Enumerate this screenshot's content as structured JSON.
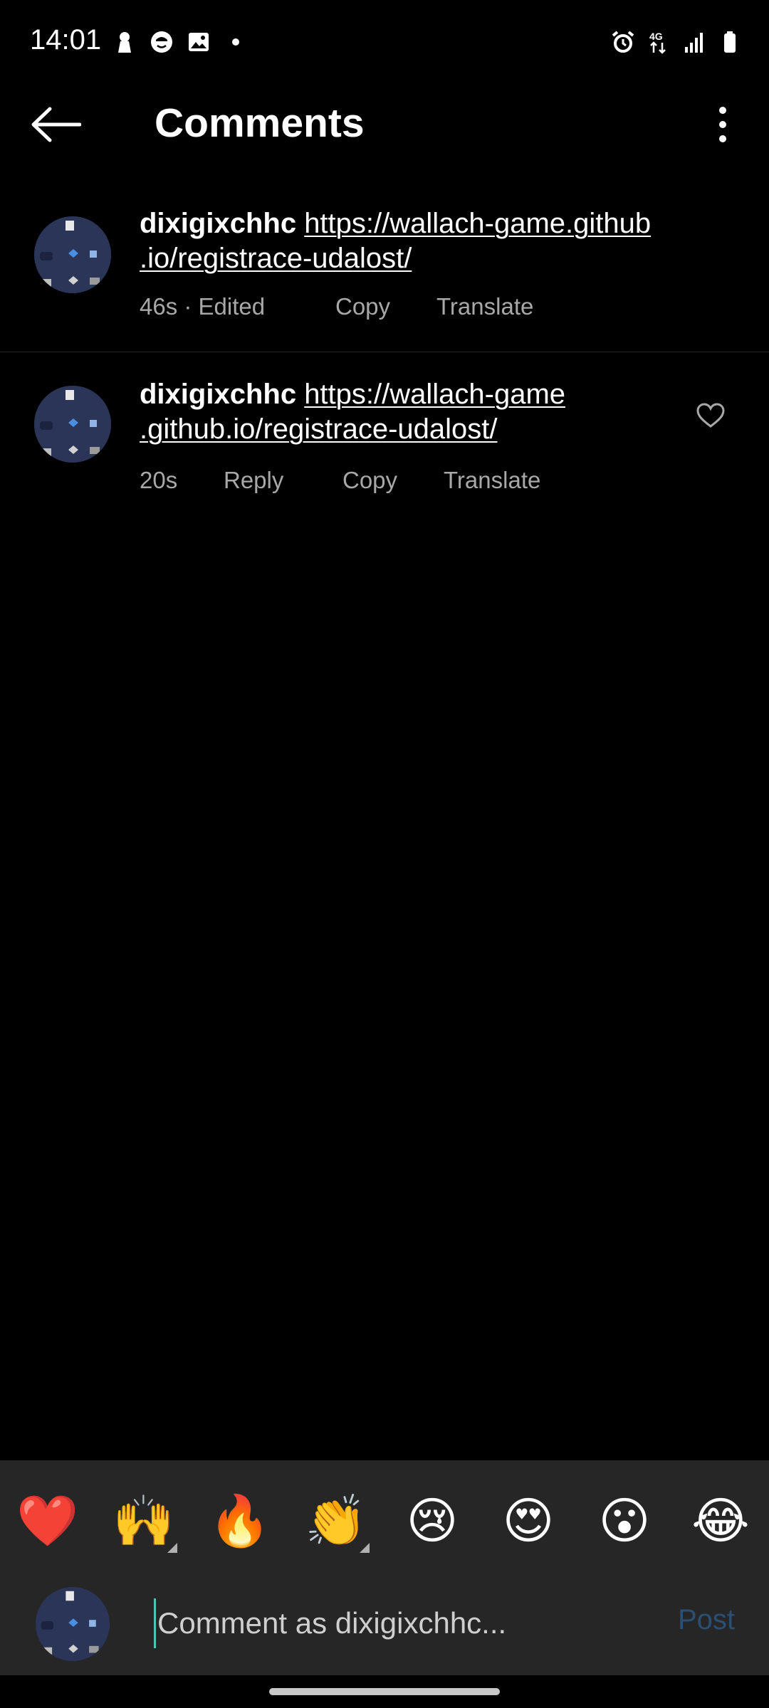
{
  "status_bar": {
    "time": "14:01",
    "left_icons": [
      "lock-person-icon",
      "face-icon",
      "image-icon",
      "dot-icon"
    ],
    "right_icons": [
      "alarm-icon",
      "network-4g-icon",
      "signal-icon",
      "battery-icon"
    ],
    "network_label": "4G"
  },
  "header": {
    "title": "Comments"
  },
  "comments": [
    {
      "username": "dixigixchhc",
      "link_line1": "https://wallach-game.github",
      "link_line2": ".io/registrace-udalost/",
      "time": "46s · Edited",
      "actions": [
        "Copy",
        "Translate"
      ]
    },
    {
      "username": "dixigixchhc",
      "link_line1": "https://wallach-game",
      "link_line2": ".github.io/registrace-udalost/",
      "time": "20s",
      "actions": [
        "Reply",
        "Copy",
        "Translate"
      ]
    }
  ],
  "emojis": [
    "❤️",
    "🙌",
    "🔥",
    "👏",
    "😢",
    "😍",
    "😮",
    "😂"
  ],
  "composer": {
    "placeholder": "Comment as dixigixchhc...",
    "post_label": "Post"
  }
}
